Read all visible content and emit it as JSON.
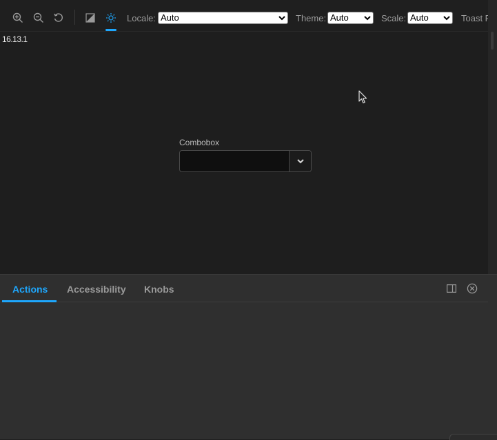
{
  "toolbar": {
    "zoom_in_icon": "zoom-in",
    "zoom_out_icon": "zoom-out",
    "reset_zoom_icon": "reset-zoom",
    "contrast_icon": "contrast",
    "theme_icon": "sun",
    "locale": {
      "label": "Locale:",
      "value": "Auto"
    },
    "theme": {
      "label": "Theme:",
      "value": "Auto"
    },
    "scale": {
      "label": "Scale:",
      "value": "Auto"
    },
    "toast_label": "Toast P"
  },
  "preview": {
    "version": "16.13.1",
    "combobox": {
      "label": "Combobox",
      "value": "",
      "button_icon": "chevron-down"
    }
  },
  "panel": {
    "tabs": [
      {
        "label": "Actions",
        "active": true
      },
      {
        "label": "Accessibility",
        "active": false
      },
      {
        "label": "Knobs",
        "active": false
      }
    ],
    "orientation_icon": "panel-right",
    "close_icon": "close-circle"
  },
  "colors": {
    "accent": "#1ea7fd",
    "background": "#1e1e1e",
    "panel_background": "#2f2f2f"
  }
}
